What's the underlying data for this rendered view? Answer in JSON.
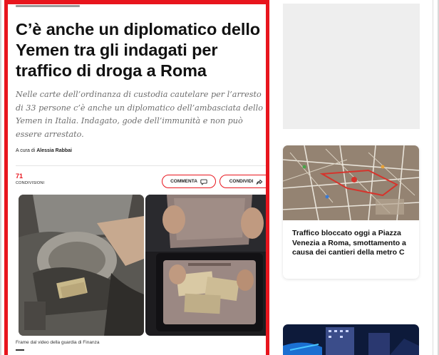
{
  "article": {
    "headline": "C’è anche un diplomatico dello Yemen tra gli indagati per traffico di droga a Roma",
    "summary": "Nelle carte dell’ordinanza di custodia cautelare per l’arresto di 33 persone c’è anche un diplomatico dell’ambasciata dello Yemen in Italia. Indagato, gode dell’immunità e non può essere arrestato.",
    "byline_prefix": "A cura di",
    "author": "Alessia Rabbai",
    "share_count": "71",
    "share_label": "CONDIVISIONI",
    "comment_label": "COMMENTA",
    "share_button_label": "CONDIVIDI",
    "photo_caption": "Frame dal video della guardia di Finanza"
  },
  "sidebar": {
    "news_card": {
      "title": "Traffico bloccato oggi a Piazza Venezia a Roma, smottamento a causa dei cantieri della metro C"
    }
  },
  "colors": {
    "accent": "#e8151d"
  },
  "icons": {
    "comment": "speech-bubble-icon",
    "share": "share-arrow-icon"
  }
}
